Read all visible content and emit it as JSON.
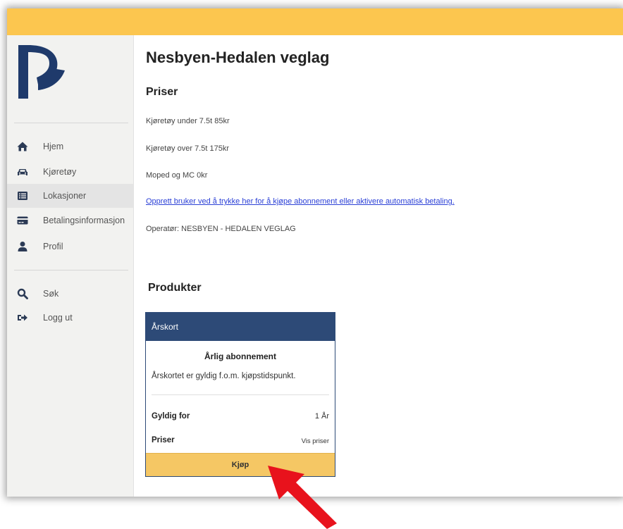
{
  "colors": {
    "topbar": "#fcc64f",
    "card_header": "#2d4a77",
    "buy_button": "#f5c764",
    "link": "#2a3fd6",
    "arrow": "#e8121c",
    "logo": "#1f3a6b"
  },
  "sidebar": {
    "logo_icon": "brand-p-logo",
    "main_nav": [
      {
        "label": "Hjem",
        "icon": "home-icon",
        "active": false
      },
      {
        "label": "Kjøretøy",
        "icon": "car-icon",
        "active": false
      },
      {
        "label": "Lokasjoner",
        "icon": "list-icon",
        "active": true
      },
      {
        "label": "Betalingsinformasjon",
        "icon": "credit-card-icon",
        "active": false
      },
      {
        "label": "Profil",
        "icon": "user-icon",
        "active": false
      }
    ],
    "secondary_nav": [
      {
        "label": "Søk",
        "icon": "search-icon"
      },
      {
        "label": "Logg ut",
        "icon": "logout-icon"
      }
    ]
  },
  "main": {
    "title": "Nesbyen-Hedalen veglag",
    "prices_heading": "Priser",
    "price_lines": [
      "Kjøretøy under 7.5t 85kr",
      "Kjøretøy over 7.5t 175kr",
      "Moped og MC 0kr"
    ],
    "signup_link": "Opprett bruker ved å trykke her for å kjøpe abonnement eller aktivere automatisk betaling.",
    "operator": "Operatør: NESBYEN - HEDALEN VEGLAG",
    "products_heading": "Produkter",
    "product": {
      "header": "Årskort",
      "name": "Årlig abonnement",
      "description": "Årskortet er gyldig f.o.m. kjøpstidspunkt.",
      "valid_label": "Gyldig for",
      "valid_value": "1 År",
      "prices_label": "Priser",
      "prices_link": "Vis priser",
      "buy_label": "Kjøp"
    }
  }
}
